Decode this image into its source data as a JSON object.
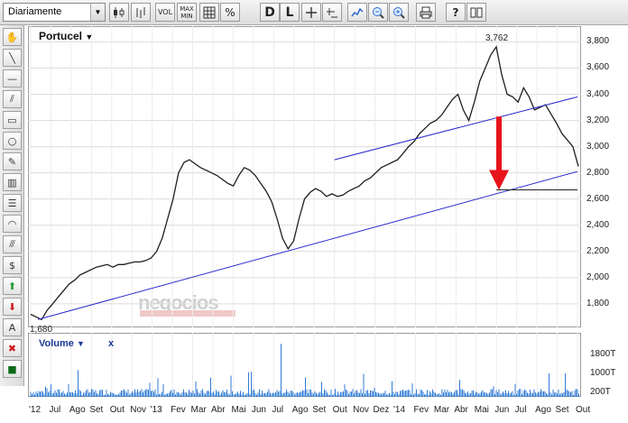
{
  "toolbar": {
    "period": "Diariamente",
    "buttons": [
      {
        "name": "candlestick-icon"
      },
      {
        "name": "bar-chart-icon"
      },
      {
        "label": "VOL"
      },
      {
        "label": "MAX\nMIN"
      },
      {
        "name": "grid-icon"
      },
      {
        "label": "%"
      },
      {
        "label": "D"
      },
      {
        "label": "L"
      },
      {
        "name": "crosshair-icon"
      },
      {
        "name": "horizontal-line-icon"
      },
      {
        "name": "line-chart-icon"
      },
      {
        "name": "zoom-out-icon"
      },
      {
        "name": "zoom-in-icon"
      },
      {
        "name": "print-icon"
      },
      {
        "label": "?"
      },
      {
        "name": "book-icon"
      }
    ]
  },
  "left_tools": [
    "hand-icon",
    "trendline-icon",
    "horizontal-line-icon",
    "channel-icon",
    "rectangle-icon",
    "ellipse-icon",
    "pencil-icon",
    "fibonacci-icon",
    "fibonacci-levels-icon",
    "arc-icon",
    "parallel-lines-icon",
    "dollar-icon",
    "buy-arrow-icon",
    "sell-arrow-icon",
    "text-icon",
    "delete-icon",
    "color-icon"
  ],
  "chart": {
    "title": "Portucel",
    "title_arrow": "▼",
    "watermark": "negocios"
  },
  "volume": {
    "title": "Volume",
    "title_arrow": "▼",
    "close": "x"
  },
  "chart_data": [
    {
      "type": "line",
      "title": "Portucel",
      "y_ticks": [
        "3,800",
        "3,600",
        "3,400",
        "3,200",
        "3,000",
        "2,800",
        "2,600",
        "2,400",
        "2,200",
        "2,000",
        "1,800"
      ],
      "ylim": [
        1.62,
        3.92
      ],
      "x_ticks": [
        "'12",
        "Jul",
        "Ago",
        "Set",
        "Out",
        "Nov",
        "'13",
        "Fev",
        "Mar",
        "Abr",
        "Mai",
        "Jun",
        "Jul",
        "Ago",
        "Set",
        "Out",
        "Nov",
        "Dez",
        "'14",
        "Fev",
        "Mar",
        "Abr",
        "Mai",
        "Jun",
        "Jul",
        "Ago",
        "Set",
        "Out"
      ],
      "annotations": [
        {
          "text": "1,680",
          "x": "Jun '12",
          "y": 1.68
        },
        {
          "text": "3,762",
          "x": "Mai '14",
          "y": 3.762
        }
      ],
      "series": [
        {
          "values": [
            1.72,
            1.7,
            1.68,
            1.75,
            1.8,
            1.85,
            1.9,
            1.95,
            1.98,
            2.02,
            2.04,
            2.06,
            2.08,
            2.09,
            2.1,
            2.08,
            2.1,
            2.1,
            2.11,
            2.12,
            2.12,
            2.13,
            2.15,
            2.2,
            2.3,
            2.45,
            2.6,
            2.8,
            2.88,
            2.9,
            2.87,
            2.84,
            2.82,
            2.8,
            2.78,
            2.75,
            2.72,
            2.7,
            2.78,
            2.84,
            2.82,
            2.78,
            2.72,
            2.66,
            2.58,
            2.45,
            2.3,
            2.22,
            2.28,
            2.45,
            2.6,
            2.65,
            2.68,
            2.66,
            2.62,
            2.64,
            2.62,
            2.63,
            2.66,
            2.68,
            2.7,
            2.74,
            2.76,
            2.8,
            2.84,
            2.86,
            2.88,
            2.9,
            2.95,
            3.0,
            3.04,
            3.1,
            3.14,
            3.18,
            3.2,
            3.24,
            3.3,
            3.36,
            3.4,
            3.28,
            3.2,
            3.34,
            3.5,
            3.6,
            3.7,
            3.762,
            3.55,
            3.4,
            3.38,
            3.34,
            3.45,
            3.38,
            3.28,
            3.3,
            3.32,
            3.25,
            3.18,
            3.1,
            3.05,
            3.0,
            2.85
          ]
        }
      ],
      "trendlines": [
        {
          "name": "long-term-support",
          "from": {
            "x": "Jun '12",
            "y": 1.68
          },
          "to": {
            "x": "Out '14",
            "y": 2.81
          }
        },
        {
          "name": "short-term-channel",
          "from": {
            "x": "Out '13",
            "y": 2.9
          },
          "to": {
            "x": "Out '14",
            "y": 3.38
          }
        },
        {
          "name": "target-level",
          "from": {
            "x": "Jun '14",
            "y": 2.67
          },
          "to": {
            "x": "Out '14",
            "y": 2.67
          }
        }
      ],
      "arrow": {
        "color": "#e8141c",
        "from_y": 3.23,
        "to_y": 2.67,
        "x": "Jun '14"
      },
      "colors": {
        "line": "#1f1f1f",
        "trendline": "#2b2bcf",
        "arrow": "#e8141c"
      }
    },
    {
      "type": "bar",
      "title": "Volume",
      "y_ticks": [
        "1800T",
        "1000T",
        "200T"
      ],
      "ylim": [
        0,
        2300
      ],
      "colors": {
        "bar": "#2f7bd6"
      }
    }
  ]
}
